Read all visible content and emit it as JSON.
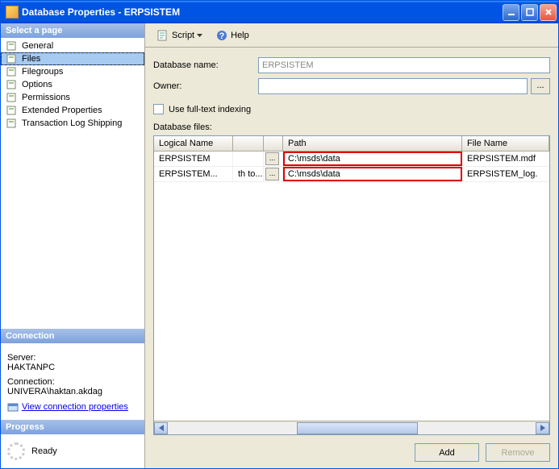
{
  "window": {
    "title": "Database Properties - ERPSISTEM"
  },
  "sidebar": {
    "select_page": "Select a page",
    "pages": [
      {
        "label": "General"
      },
      {
        "label": "Files"
      },
      {
        "label": "Filegroups"
      },
      {
        "label": "Options"
      },
      {
        "label": "Permissions"
      },
      {
        "label": "Extended Properties"
      },
      {
        "label": "Transaction Log Shipping"
      }
    ],
    "connection_header": "Connection",
    "server_label": "Server:",
    "server_value": "HAKTANPC",
    "connection_label": "Connection:",
    "connection_value": "UNIVERA\\haktan.akdag",
    "view_conn_label": "View connection properties",
    "progress_header": "Progress",
    "progress_status": "Ready"
  },
  "toolbar": {
    "script_label": "Script",
    "help_label": "Help"
  },
  "form": {
    "dbname_label": "Database name:",
    "dbname_value": "ERPSISTEM",
    "owner_label": "Owner:",
    "owner_value": "",
    "fulltext_label": "Use full-text indexing",
    "files_label": "Database files:"
  },
  "grid": {
    "headers": {
      "logical": "Logical Name",
      "path": "Path",
      "filename": "File Name"
    },
    "rows": [
      {
        "logical": "ERPSISTEM",
        "autogrow": "",
        "path": "C:\\msds\\data",
        "filename": "ERPSISTEM.mdf"
      },
      {
        "logical": "ERPSISTEM...",
        "autogrow": "th to...",
        "path": "C:\\msds\\data",
        "filename": "ERPSISTEM_log."
      }
    ]
  },
  "buttons": {
    "add": "Add",
    "remove": "Remove",
    "ellipsis": "..."
  }
}
